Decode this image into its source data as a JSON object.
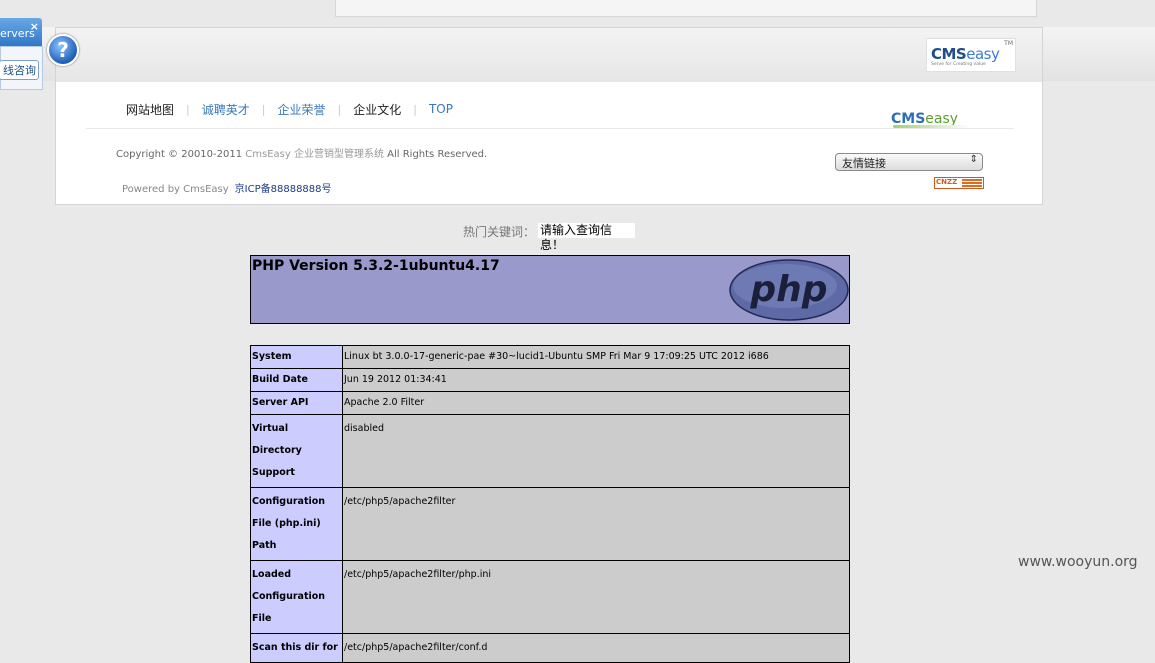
{
  "footer": {
    "logo_top": {
      "cms": "CMS",
      "easy": "easy",
      "tm": "TM",
      "tagline": "Serve for Creating value"
    },
    "nav": [
      {
        "label": "网站地图",
        "accent": false
      },
      {
        "label": "诚聘英才",
        "accent": true
      },
      {
        "label": "企业荣誉",
        "accent": true
      },
      {
        "label": "企业文化",
        "accent": false
      },
      {
        "label": "TOP",
        "accent": true
      }
    ],
    "logo_mid": {
      "cms": "CMS",
      "easy": "easy"
    },
    "copyright": {
      "pre": "Copyright © 20010-2011 ",
      "mid": "CmsEasy 企业营销型管理系统",
      "post": " All Rights Reserved."
    },
    "powered": {
      "text": "Powered by CmsEasy",
      "icp": "京ICP备88888888号"
    },
    "friend_links": {
      "selected": "友情链接"
    },
    "cnzz": "CNZZ"
  },
  "hot_keywords": {
    "label": "热门关键词：",
    "value": "请输入查询信息！"
  },
  "phpinfo": {
    "version": "PHP Version 5.3.2-1ubuntu4.17",
    "logo_text": "php",
    "rows": [
      {
        "key": "System",
        "value": "Linux bt 3.0.0-17-generic-pae #30~lucid1-Ubuntu SMP Fri Mar 9 17:09:25 UTC 2012 i686"
      },
      {
        "key": "Build Date",
        "value": "Jun 19 2012 01:34:41"
      },
      {
        "key": "Server API",
        "value": "Apache 2.0 Filter"
      },
      {
        "key": "Virtual Directory Support",
        "value": "disabled"
      },
      {
        "key": "Configuration File (php.ini) Path",
        "value": "/etc/php5/apache2filter"
      },
      {
        "key": "Loaded Configuration File",
        "value": "/etc/php5/apache2filter/php.ini"
      },
      {
        "key": "Scan this dir for",
        "value": "/etc/php5/apache2filter/conf.d"
      }
    ]
  },
  "float_widget": {
    "title": "ervers",
    "close": "×",
    "consult": "线咨询"
  },
  "help": "?",
  "watermark": "www.wooyun.org"
}
